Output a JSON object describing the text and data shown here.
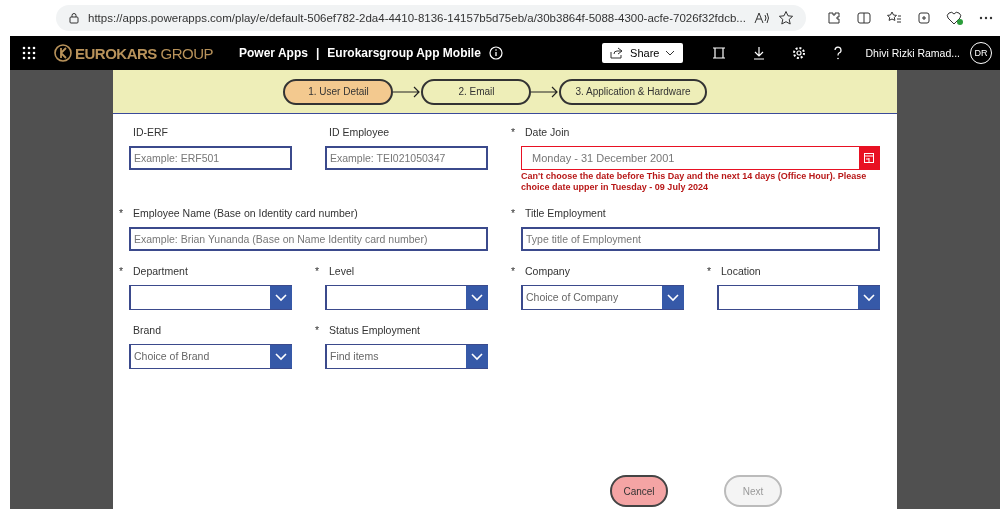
{
  "browser": {
    "url": "https://apps.powerapps.com/play/e/default-506ef782-2da4-4410-8136-14157b5d75eb/a/30b3864f-5088-4300-acfe-7026f32fdcb..."
  },
  "header": {
    "logo": "EUROKARS",
    "logo_suffix": "GROUP",
    "app": "Power Apps",
    "separator": "|",
    "title": "Eurokarsgroup App Mobile",
    "share": "Share",
    "user": "Dhivi Rizki Ramad...",
    "initials": "DR"
  },
  "steps": [
    {
      "label": "1. User Detail",
      "selected": true
    },
    {
      "label": "2. Email",
      "selected": false
    },
    {
      "label": "3. Application & Hardware",
      "selected": false
    }
  ],
  "fields": [
    {
      "kind": "text",
      "label": "ID-ERF",
      "placeholder": "Example: ERF501"
    },
    {
      "kind": "text",
      "label": "ID Employee",
      "placeholder": "Example: TEI021050347"
    },
    {
      "kind": "date",
      "label": "Date Join",
      "required_mark": "*",
      "value": "Monday - 31 December 2001",
      "invalid": true,
      "error": "Can't choose the date before This Day and the next 14 days (Office Hour). Please choice date upper in Tuesday - 09 July 2024"
    },
    {
      "kind": "text",
      "label": "Employee Name (Base on Identity card number)",
      "required_mark": "*",
      "placeholder": "Example: Brian Yunanda (Base on Name Identity card number)"
    },
    {
      "kind": "text",
      "label": "Title Employment",
      "required_mark": "*",
      "placeholder": "Type title of Employment"
    },
    {
      "kind": "dropdown",
      "label": "Department",
      "required_mark": "*"
    },
    {
      "kind": "dropdown",
      "label": "Level",
      "required_mark": "*"
    },
    {
      "kind": "dropdown",
      "label": "Company",
      "required_mark": "*",
      "placeholder": "Choice of Company"
    },
    {
      "kind": "dropdown",
      "label": "Location",
      "required_mark": "*"
    },
    {
      "kind": "dropdown",
      "label": "Brand",
      "placeholder": "Choice of Brand"
    },
    {
      "kind": "dropdown",
      "label": "Status Employment",
      "required_mark": "*",
      "placeholder": "Find items"
    }
  ],
  "buttons": [
    {
      "label": "Cancel",
      "disabled": false
    },
    {
      "label": "Next",
      "disabled": true
    }
  ]
}
